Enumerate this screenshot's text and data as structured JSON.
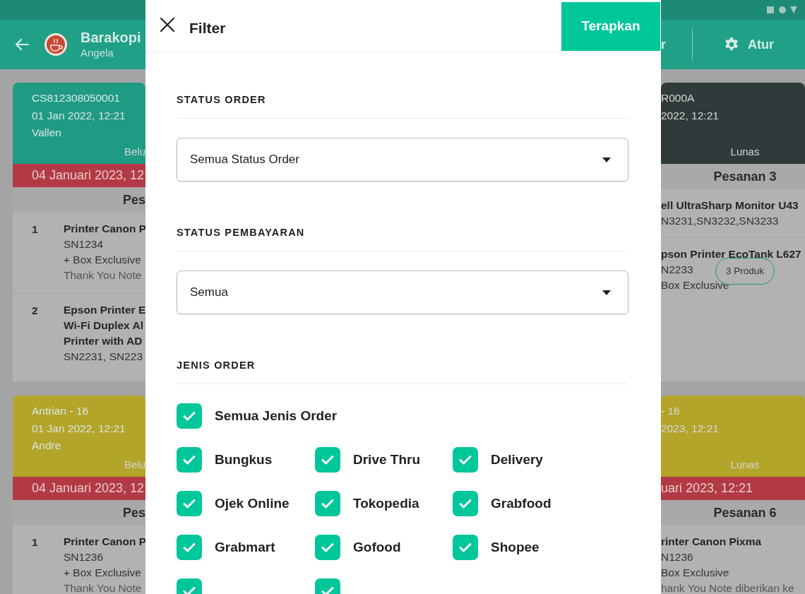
{
  "app_bar": {
    "store_name": "Barakopi",
    "user_name": "Angela",
    "right_cut_label": "r",
    "settings_label": "Atur"
  },
  "left_column": {
    "cards": [
      {
        "color": "#1f9b84",
        "header_lines": [
          "CS812308050001",
          "01 Jan 2022, 12:21",
          "Vallen"
        ],
        "payment": "Belu",
        "date_bar": "04 Januari 2023, 12",
        "order_title": "Pes",
        "items": [
          {
            "number": "1",
            "lines": [
              {
                "kind": "title",
                "text": "Printer Canon P"
              },
              {
                "kind": "detail",
                "text": "SN1234"
              },
              {
                "kind": "detail",
                "text": "+ Box Exclusive"
              },
              {
                "kind": "note",
                "text": "Thank You Note"
              }
            ]
          },
          {
            "number": "2",
            "lines": [
              {
                "kind": "title",
                "text": "Epson Printer E"
              },
              {
                "kind": "title",
                "text": "Wi-Fi Duplex Al"
              },
              {
                "kind": "title",
                "text": "Printer with AD"
              },
              {
                "kind": "detail",
                "text": "SN2231, SN223"
              }
            ]
          }
        ]
      },
      {
        "color": "#b3a52a",
        "header_lines": [
          "Antrian - 16",
          "01 Jan 2022, 12:21",
          "Andre"
        ],
        "payment": "Belu",
        "date_bar": "04 Januari 2023, 12",
        "order_title": "Pes",
        "items": [
          {
            "number": "1",
            "lines": [
              {
                "kind": "title",
                "text": "Printer Canon P"
              },
              {
                "kind": "detail",
                "text": "SN1236"
              },
              {
                "kind": "detail",
                "text": "+ Box Exclusive"
              },
              {
                "kind": "note",
                "text": "Thank You Note"
              }
            ]
          }
        ]
      }
    ]
  },
  "right_column": {
    "cards": [
      {
        "color": "#303a3a",
        "header_lines": [
          "R000A",
          "2022, 12:21"
        ],
        "payment": "Lunas",
        "order_title": "Pesanan  3",
        "items": [
          {
            "lines": [
              {
                "kind": "title",
                "text": "ell UltraSharp Monitor U43"
              },
              {
                "kind": "detail",
                "text": "N3231,SN3232,SN3233"
              }
            ]
          },
          {
            "lines": [
              {
                "kind": "title",
                "text": "pson Printer EcoTank L627"
              },
              {
                "kind": "detail",
                "text": "N2233"
              },
              {
                "kind": "detail",
                "text": "Box Exclusive"
              }
            ],
            "badge": "3 Produk"
          }
        ]
      },
      {
        "color": "#b3a52a",
        "header_lines": [
          "- 16",
          "2023, 12:21"
        ],
        "payment": "Lunas",
        "date_bar": "uari 2023, 12:21",
        "order_title": "Pesanan  6",
        "items": [
          {
            "lines": [
              {
                "kind": "title",
                "text": "rinter Canon Pixma"
              },
              {
                "kind": "detail",
                "text": "N1236"
              },
              {
                "kind": "detail",
                "text": "Box Exclusive"
              },
              {
                "kind": "note",
                "text": "hank You Note diberikan ke"
              }
            ]
          }
        ]
      }
    ]
  },
  "filter": {
    "title": "Filter",
    "apply_button": "Terapkan",
    "sections": [
      {
        "kind": "dropdown",
        "label": "STATUS ORDER",
        "value": "Semua Status Order"
      },
      {
        "kind": "dropdown",
        "label": "STATUS PEMBAYARAN",
        "value": "Semua"
      },
      {
        "kind": "checkboxes",
        "label": "JENIS ORDER",
        "all": {
          "label": "Semua Jenis Order",
          "checked": true
        },
        "options": [
          {
            "label": "Bungkus",
            "checked": true
          },
          {
            "label": "Drive Thru",
            "checked": true
          },
          {
            "label": "Delivery",
            "checked": true
          },
          {
            "label": "Ojek Online",
            "checked": true
          },
          {
            "label": "Tokopedia",
            "checked": true
          },
          {
            "label": "Grabfood",
            "checked": true
          },
          {
            "label": "Grabmart",
            "checked": true
          },
          {
            "label": "Gofood",
            "checked": true
          },
          {
            "label": "Shopee",
            "checked": true
          },
          {
            "checked": true
          },
          {
            "checked": true
          }
        ]
      }
    ]
  }
}
